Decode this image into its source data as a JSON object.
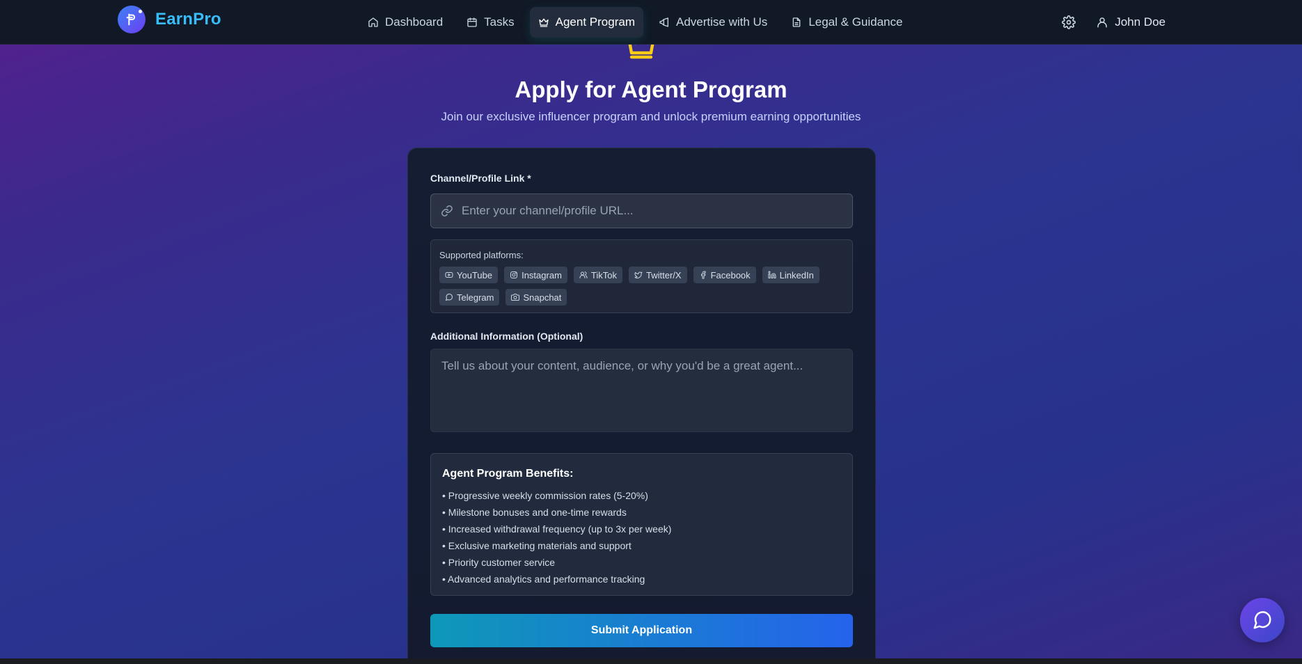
{
  "brand": {
    "name": "EarnPro"
  },
  "nav": {
    "items": [
      {
        "label": "Dashboard",
        "icon": "home-icon"
      },
      {
        "label": "Tasks",
        "icon": "calendar-icon"
      },
      {
        "label": "Agent Program",
        "icon": "crown-icon",
        "active": true
      },
      {
        "label": "Advertise with Us",
        "icon": "megaphone-icon"
      },
      {
        "label": "Legal & Guidance",
        "icon": "document-icon"
      }
    ]
  },
  "user": {
    "name": "John Doe"
  },
  "hero": {
    "title": "Apply for Agent Program",
    "subtitle": "Join our exclusive influencer program and unlock premium earning opportunities"
  },
  "form": {
    "link_label": "Channel/Profile Link *",
    "link_placeholder": "Enter your channel/profile URL...",
    "platforms_title": "Supported platforms:",
    "platforms": [
      "YouTube",
      "Instagram",
      "TikTok",
      "Twitter/X",
      "Facebook",
      "LinkedIn",
      "Telegram",
      "Snapchat"
    ],
    "info_label": "Additional Information (Optional)",
    "info_placeholder": "Tell us about your content, audience, or why you'd be a great agent...",
    "benefits_title": "Agent Program Benefits:",
    "benefits": [
      "• Progressive weekly commission rates (5-20%)",
      "• Milestone bonuses and one-time rewards",
      "• Increased withdrawal frequency (up to 3x per week)",
      "• Exclusive marketing materials and support",
      "• Priority customer service",
      "• Advanced analytics and performance tracking"
    ],
    "submit_label": "Submit Application"
  },
  "colors": {
    "accent": "#38bdf8",
    "crown": "#facc15",
    "submit_start": "#0e98b8",
    "submit_end": "#2563eb"
  }
}
